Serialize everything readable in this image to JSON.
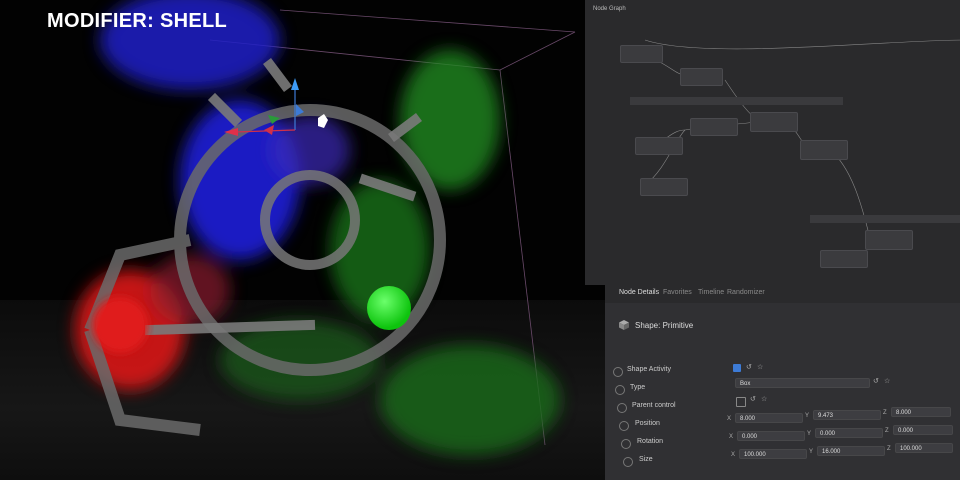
{
  "title": "MODIFIER: SHELL",
  "graph": {
    "title": "Node Graph"
  },
  "tabs": [
    "Node Details",
    "Favorites",
    "Timeline",
    "Randomizer"
  ],
  "details": {
    "shape_title": "Shape: Primitive",
    "rows": [
      {
        "label": "Shape Activity"
      },
      {
        "label": "Type",
        "value": "Box"
      },
      {
        "label": "Parent control"
      },
      {
        "label": "Position",
        "x": "8.000",
        "y": "9.473",
        "z": "8.000"
      },
      {
        "label": "Rotation",
        "x": "0.000",
        "y": "0.000",
        "z": "0.000"
      },
      {
        "label": "Size",
        "x": "100.000",
        "y": "16.000",
        "z": "100.000"
      }
    ],
    "axis": {
      "x": "X",
      "y": "Y",
      "z": "Z"
    }
  },
  "colors": {
    "accent": "#3d7bd6",
    "graph_bg": "#2a2a2c",
    "details_bg": "#303033"
  }
}
